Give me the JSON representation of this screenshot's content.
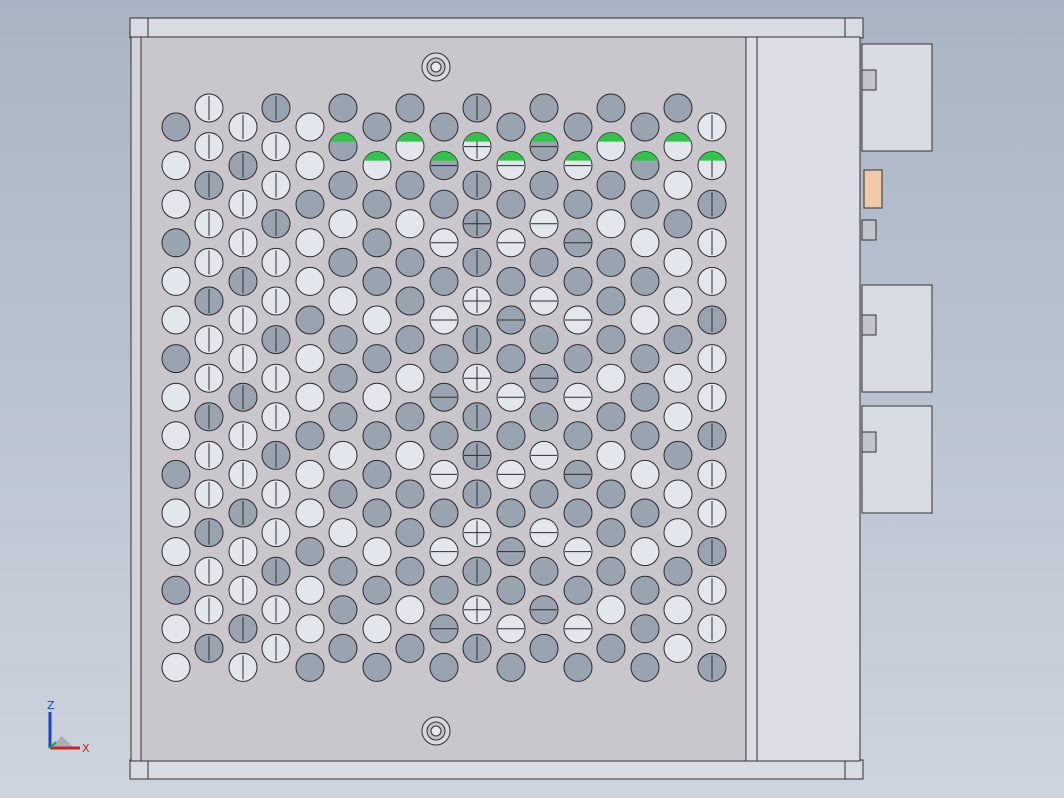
{
  "view": {
    "background_top": "#a9b4c3",
    "background_bottom": "#cdd4de",
    "housing_color": "#c9c6cc",
    "end_cap_color": "#dcdde6",
    "hole_dark": "#9aa4b0",
    "hole_light": "#e4e6ee",
    "highlight_green": "#33c24a",
    "terminal_color": "#d8dbe2",
    "led_color": "#f0c9a8"
  },
  "triad": {
    "z_label": "Z",
    "x_label": "X",
    "z_color": "#1f3fd0",
    "x_color": "#d02424",
    "y_color": "#24a040"
  }
}
